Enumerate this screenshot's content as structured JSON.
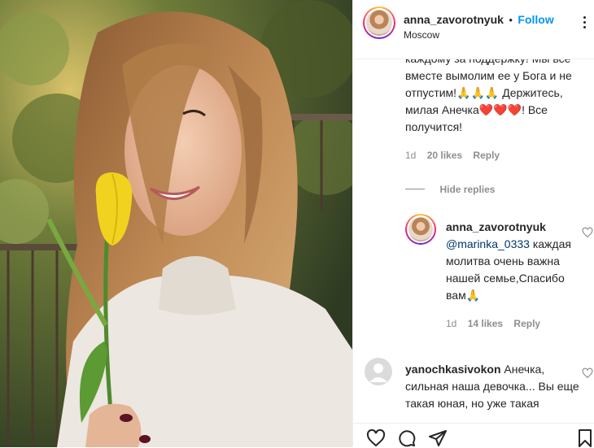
{
  "post": {
    "username": "anna_zavorotnyuk",
    "separator": "•",
    "follow_label": "Follow",
    "location": "Moscow"
  },
  "comments": {
    "top_partial_line": "каждому за поддержку! Мы все",
    "top_lines": [
      "вместе вымолим ее у Бога и не",
      "отпустим!🙏🙏🙏 Держитесь,",
      "милая Анечка❤️❤️❤️! Все",
      "получится!"
    ],
    "top_meta": {
      "time": "1d",
      "likes": "20 likes",
      "reply": "Reply"
    },
    "hide_replies": "Hide replies",
    "reply": {
      "username": "anna_zavorotnyuk",
      "mention": "@marinka_0333",
      "lines_first": " каждая",
      "lines": [
        "молитва очень важна",
        "нашей семье,Спасибо",
        "вам🙏"
      ],
      "meta": {
        "time": "1d",
        "likes": "14 likes",
        "reply": "Reply"
      }
    },
    "next": {
      "username": "yanochkasivokon",
      "text_first": " Анечка,",
      "lines": [
        "сильная наша девочка... Вы еще",
        "такая юная, но уже такая"
      ]
    }
  },
  "icons": {
    "like": "heart-icon",
    "comment": "comment-icon",
    "share": "share-icon",
    "save": "bookmark-icon",
    "more": "more-options-icon"
  },
  "colors": {
    "accent": "#0095f6",
    "text": "#262626",
    "muted": "#8e8e8e"
  }
}
